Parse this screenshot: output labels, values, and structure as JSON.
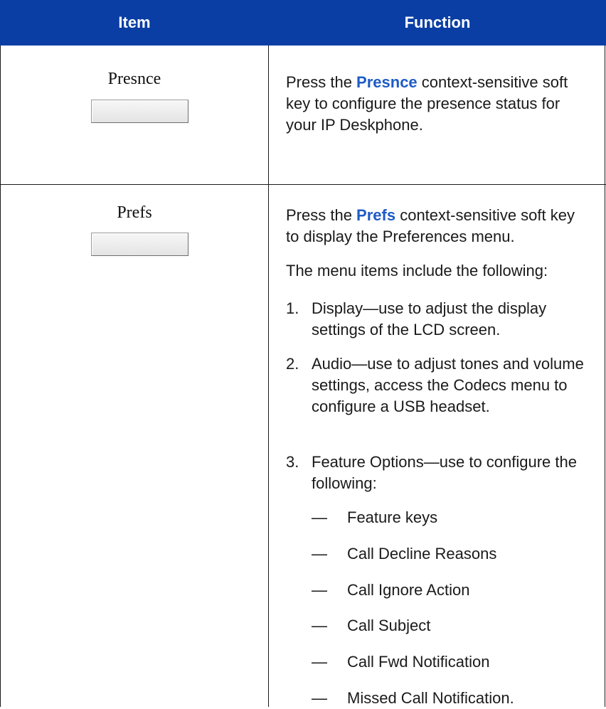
{
  "table": {
    "headers": {
      "item": "Item",
      "function": "Function"
    },
    "rows": [
      {
        "key_label": "Presnce",
        "func_prefix": "Press the ",
        "func_key": "Presnce",
        "func_suffix": " context-sensitive soft key to configure the presence status for your IP Deskphone."
      },
      {
        "key_label": "Prefs",
        "func_prefix": "Press the ",
        "func_key": "Prefs",
        "func_suffix": " context-sensitive soft key to display the Preferences menu.",
        "intro": "The menu items include the following:",
        "items": [
          {
            "num": "1.",
            "text": "Display—use to adjust the display settings of the LCD screen."
          },
          {
            "num": "2.",
            "text": "Audio—use to adjust tones and volume settings, access the Codecs menu to configure a USB headset."
          },
          {
            "num": "3.",
            "text": "Feature Options—use to configure the following:"
          }
        ],
        "subitems": [
          {
            "dash": "—",
            "text": "Feature keys"
          },
          {
            "dash": "—",
            "text": "Call Decline Reasons"
          },
          {
            "dash": "—",
            "text": "Call Ignore Action"
          },
          {
            "dash": "—",
            "text": "Call Subject"
          },
          {
            "dash": "—",
            "text": "Call Fwd Notification"
          },
          {
            "dash": "—",
            "text": "Missed Call Notification."
          }
        ]
      }
    ]
  },
  "colors": {
    "header_bg": "#0a3ea4",
    "key_highlight": "#1e5bc6"
  }
}
